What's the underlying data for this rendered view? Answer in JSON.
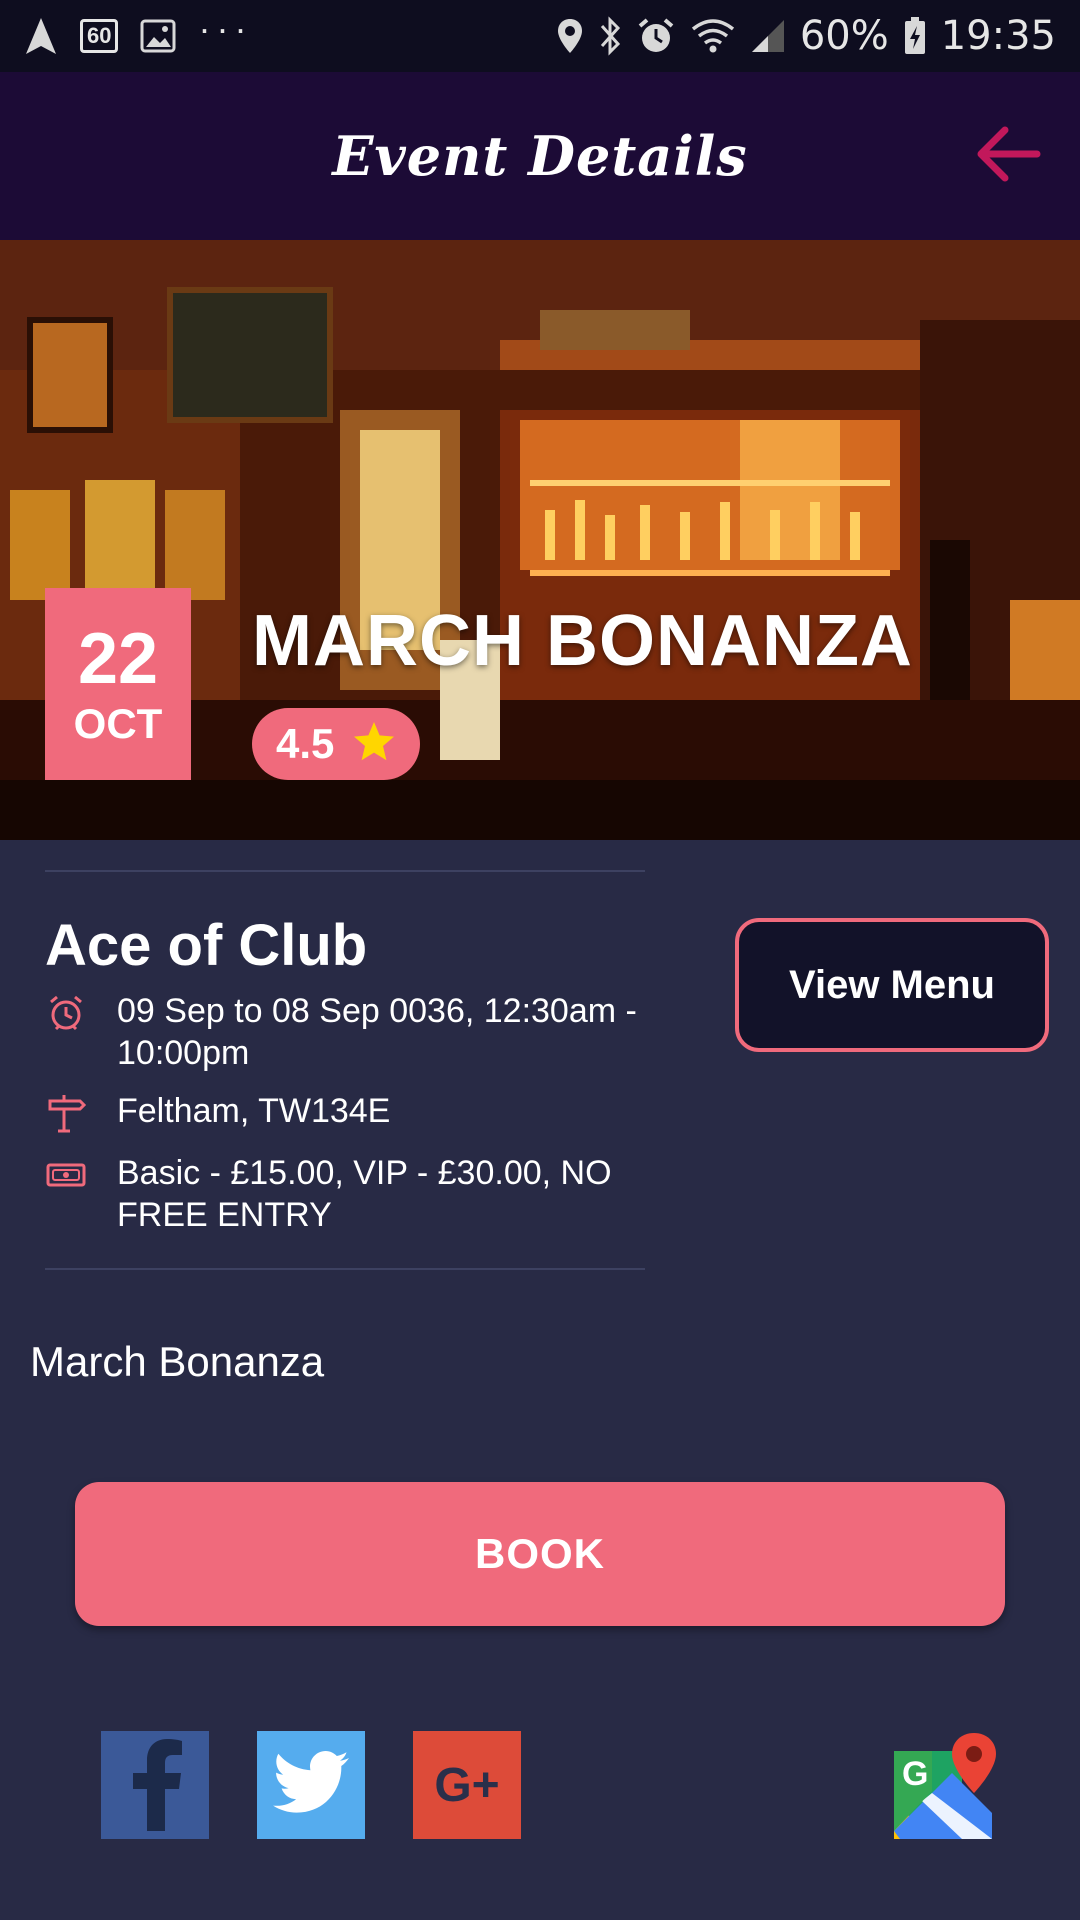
{
  "status_bar": {
    "badge_60": "60",
    "dots": "···",
    "battery_pct": "60%",
    "time": "19:35"
  },
  "header": {
    "title": "Event Details",
    "back_icon": "arrow-left-icon",
    "back_color": "#c2185b"
  },
  "event": {
    "day": "22",
    "month": "OCT",
    "title": "MARCH BONANZA",
    "rating": "4.5",
    "rating_icon": "star-icon",
    "star_color": "#ffd600"
  },
  "details": {
    "venue": "Ace of Club",
    "datetime": "09 Sep to 08 Sep 0036, 12:30am - 10:00pm",
    "location": "Feltham, TW134E",
    "prices": "Basic - £15.00, VIP - £30.00, NO FREE ENTRY",
    "view_menu_label": "View Menu"
  },
  "description": "March Bonanza",
  "book_label": "BOOK",
  "social": {
    "facebook": "facebook-icon",
    "twitter": "twitter-icon",
    "google_plus": "google-plus-icon",
    "google_plus_text": "G+",
    "maps": "google-maps-icon",
    "maps_text": "G"
  },
  "colors": {
    "accent": "#f06a7c",
    "background": "#282a45",
    "header": "#1c0b36"
  }
}
